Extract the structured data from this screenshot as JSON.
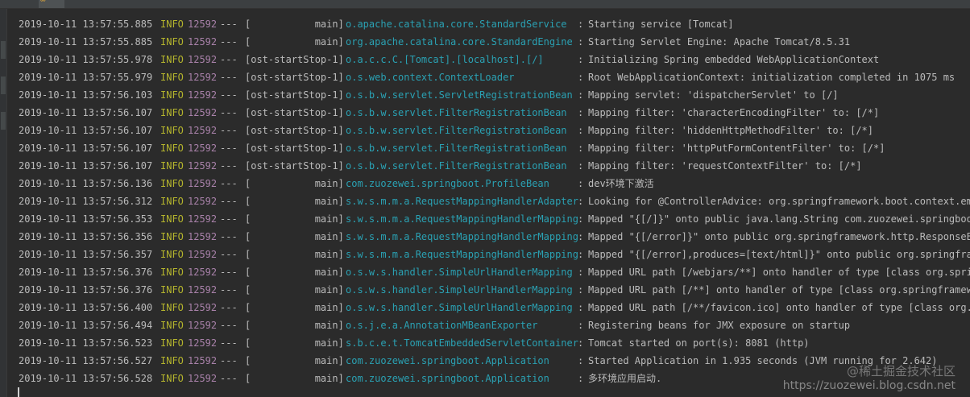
{
  "colors": {
    "background": "#2b2b2b",
    "text": "#bbbbbb",
    "level_info": "#b4b42d",
    "pid": "#a881a9",
    "logger": "#2aa1b3"
  },
  "icons": {
    "top_tab": "run-console-tab-icon"
  },
  "log": {
    "rows": [
      {
        "ts": "2019-10-11 13:57:55.885",
        "level": "INFO",
        "pid": "12592",
        "sep": "---",
        "thread": "[           main]",
        "logger": "o.apache.catalina.core.StandardService",
        "message": "Starting service [Tomcat]"
      },
      {
        "ts": "2019-10-11 13:57:55.885",
        "level": "INFO",
        "pid": "12592",
        "sep": "---",
        "thread": "[           main]",
        "logger": "org.apache.catalina.core.StandardEngine",
        "message": "Starting Servlet Engine: Apache Tomcat/8.5.31"
      },
      {
        "ts": "2019-10-11 13:57:55.978",
        "level": "INFO",
        "pid": "12592",
        "sep": "---",
        "thread": "[ost-startStop-1]",
        "logger": "o.a.c.c.C.[Tomcat].[localhost].[/]",
        "message": "Initializing Spring embedded WebApplicationContext"
      },
      {
        "ts": "2019-10-11 13:57:55.979",
        "level": "INFO",
        "pid": "12592",
        "sep": "---",
        "thread": "[ost-startStop-1]",
        "logger": "o.s.web.context.ContextLoader",
        "message": "Root WebApplicationContext: initialization completed in 1075 ms"
      },
      {
        "ts": "2019-10-11 13:57:56.103",
        "level": "INFO",
        "pid": "12592",
        "sep": "---",
        "thread": "[ost-startStop-1]",
        "logger": "o.s.b.w.servlet.ServletRegistrationBean",
        "message": "Mapping servlet: 'dispatcherServlet' to [/]"
      },
      {
        "ts": "2019-10-11 13:57:56.107",
        "level": "INFO",
        "pid": "12592",
        "sep": "---",
        "thread": "[ost-startStop-1]",
        "logger": "o.s.b.w.servlet.FilterRegistrationBean",
        "message": "Mapping filter: 'characterEncodingFilter' to: [/*]"
      },
      {
        "ts": "2019-10-11 13:57:56.107",
        "level": "INFO",
        "pid": "12592",
        "sep": "---",
        "thread": "[ost-startStop-1]",
        "logger": "o.s.b.w.servlet.FilterRegistrationBean",
        "message": "Mapping filter: 'hiddenHttpMethodFilter' to: [/*]"
      },
      {
        "ts": "2019-10-11 13:57:56.107",
        "level": "INFO",
        "pid": "12592",
        "sep": "---",
        "thread": "[ost-startStop-1]",
        "logger": "o.s.b.w.servlet.FilterRegistrationBean",
        "message": "Mapping filter: 'httpPutFormContentFilter' to: [/*]"
      },
      {
        "ts": "2019-10-11 13:57:56.107",
        "level": "INFO",
        "pid": "12592",
        "sep": "---",
        "thread": "[ost-startStop-1]",
        "logger": "o.s.b.w.servlet.FilterRegistrationBean",
        "message": "Mapping filter: 'requestContextFilter' to: [/*]"
      },
      {
        "ts": "2019-10-11 13:57:56.136",
        "level": "INFO",
        "pid": "12592",
        "sep": "---",
        "thread": "[           main]",
        "logger": "com.zuozewei.springboot.ProfileBean",
        "message": "dev环境下激活"
      },
      {
        "ts": "2019-10-11 13:57:56.312",
        "level": "INFO",
        "pid": "12592",
        "sep": "---",
        "thread": "[           main]",
        "logger": "s.w.s.m.m.a.RequestMappingHandlerAdapter",
        "message": "Looking for @ControllerAdvice: org.springframework.boot.context.embe"
      },
      {
        "ts": "2019-10-11 13:57:56.353",
        "level": "INFO",
        "pid": "12592",
        "sep": "---",
        "thread": "[           main]",
        "logger": "s.w.s.m.m.a.RequestMappingHandlerMapping",
        "message": "Mapped \"{[/]}\" onto public java.lang.String com.zuozewei.springboot."
      },
      {
        "ts": "2019-10-11 13:57:56.356",
        "level": "INFO",
        "pid": "12592",
        "sep": "---",
        "thread": "[           main]",
        "logger": "s.w.s.m.m.a.RequestMappingHandlerMapping",
        "message": "Mapped \"{[/error]}\" onto public org.springframework.http.ResponseEnt"
      },
      {
        "ts": "2019-10-11 13:57:56.357",
        "level": "INFO",
        "pid": "12592",
        "sep": "---",
        "thread": "[           main]",
        "logger": "s.w.s.m.m.a.RequestMappingHandlerMapping",
        "message": "Mapped \"{[/error],produces=[text/html]}\" onto public org.springframe"
      },
      {
        "ts": "2019-10-11 13:57:56.376",
        "level": "INFO",
        "pid": "12592",
        "sep": "---",
        "thread": "[           main]",
        "logger": "o.s.w.s.handler.SimpleUrlHandlerMapping",
        "message": "Mapped URL path [/webjars/**] onto handler of type [class org.spring"
      },
      {
        "ts": "2019-10-11 13:57:56.376",
        "level": "INFO",
        "pid": "12592",
        "sep": "---",
        "thread": "[           main]",
        "logger": "o.s.w.s.handler.SimpleUrlHandlerMapping",
        "message": "Mapped URL path [/**] onto handler of type [class org.springframewor"
      },
      {
        "ts": "2019-10-11 13:57:56.400",
        "level": "INFO",
        "pid": "12592",
        "sep": "---",
        "thread": "[           main]",
        "logger": "o.s.w.s.handler.SimpleUrlHandlerMapping",
        "message": "Mapped URL path [/**/favicon.ico] onto handler of type [class org.sp"
      },
      {
        "ts": "2019-10-11 13:57:56.494",
        "level": "INFO",
        "pid": "12592",
        "sep": "---",
        "thread": "[           main]",
        "logger": "o.s.j.e.a.AnnotationMBeanExporter",
        "message": "Registering beans for JMX exposure on startup"
      },
      {
        "ts": "2019-10-11 13:57:56.523",
        "level": "INFO",
        "pid": "12592",
        "sep": "---",
        "thread": "[           main]",
        "logger": "s.b.c.e.t.TomcatEmbeddedServletContainer",
        "message": "Tomcat started on port(s): 8081 (http)"
      },
      {
        "ts": "2019-10-11 13:57:56.527",
        "level": "INFO",
        "pid": "12592",
        "sep": "---",
        "thread": "[           main]",
        "logger": "com.zuozewei.springboot.Application",
        "message": "Started Application in 1.935 seconds (JVM running for 2.642)"
      },
      {
        "ts": "2019-10-11 13:57:56.528",
        "level": "INFO",
        "pid": "12592",
        "sep": "---",
        "thread": "[           main]",
        "logger": "com.zuozewei.springboot.Application",
        "message": "多环境应用启动."
      }
    ]
  },
  "watermark": {
    "line1": "@稀土掘金技术社区",
    "line2": "https://zuozewei.blog.csdn.net"
  }
}
